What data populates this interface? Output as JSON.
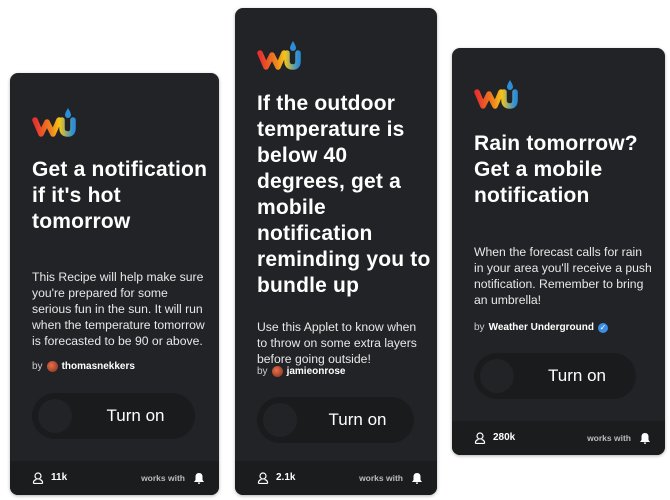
{
  "cards": [
    {
      "title": "Get a notification if it's hot tomorrow",
      "description": "This Recipe will help make sure you're prepared for some serious fun in the sun. It will run when the temperature tomorrow is forecasted to be 90 or above.",
      "by": "by",
      "author": "thomasnekkers",
      "button": "Turn on",
      "users": "11k",
      "works_with": "works with",
      "icon": "bell-icon"
    },
    {
      "title": "If the outdoor temperature is below 40 degrees, get a mobile notification reminding you to bundle up",
      "description": "Use this Applet to know when to throw on some extra layers before going outside!",
      "by": "by",
      "author": "jamieonrose",
      "button": "Turn on",
      "users": "2.1k",
      "works_with": "works with",
      "icon": "bell-icon"
    },
    {
      "title": "Rain tomorrow? Get a mobile notification",
      "description": "When the forecast calls for rain in your area you'll receive a push notification. Remember to bring an umbrella!",
      "by": "by",
      "author": "Weather Underground",
      "verified": true,
      "button": "Turn on",
      "users": "280k",
      "works_with": "works with",
      "icon": "bell-icon"
    }
  ],
  "colors": {
    "card": "#222326",
    "footer": "#1b1c1e",
    "verified": "#3a8ee6"
  }
}
